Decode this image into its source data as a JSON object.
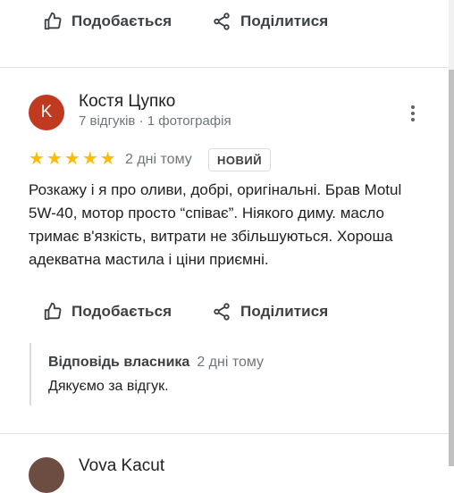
{
  "actions": {
    "like_label": "Подобається",
    "share_label": "Поділитися"
  },
  "review": {
    "author_initial": "K",
    "author_name": "Костя Цупко",
    "author_meta": "7 відгуків · 1 фотографія",
    "rating": 5,
    "time": "2 дні тому",
    "badge": "НОВИЙ",
    "text": "Розкажу і я про оливи, добрі, оригінальні. Брав Motul 5W-40, мотор просто “співає”. Ніякого диму. масло тримає в'язкість, витрати не збільшуються. Хороша адекватна мастила і ціни приємні."
  },
  "owner_reply": {
    "title": "Відповідь власника",
    "time": "2 дні тому",
    "text": "Дякуємо за відгук."
  },
  "next_review": {
    "author_name": "Vova Kacut"
  },
  "colors": {
    "star": "#fbbc04",
    "avatar": "#bf3a1f"
  }
}
